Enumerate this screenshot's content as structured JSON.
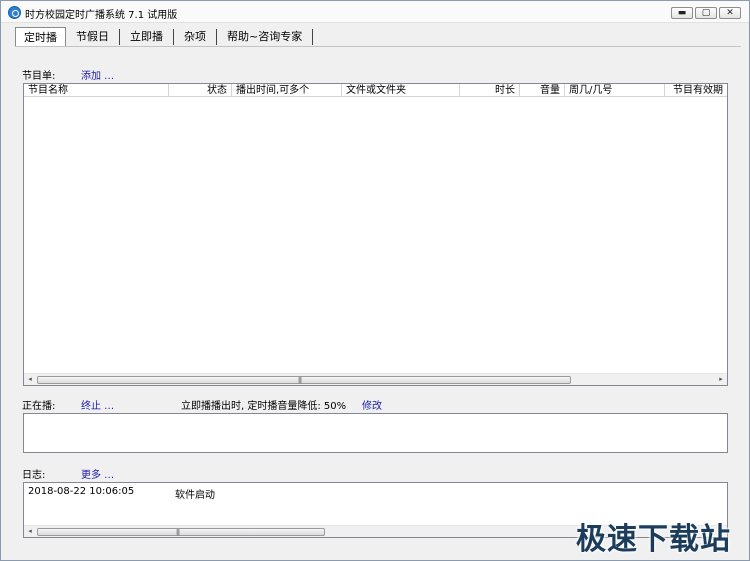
{
  "window": {
    "title": "时方校园定时广播系统 7.1 试用版",
    "buttons": {
      "minimize": "▬",
      "maximize": "▢",
      "close": "✕"
    }
  },
  "tabs": [
    {
      "label": "定时播",
      "active": true
    },
    {
      "label": "节假日"
    },
    {
      "label": "立即播"
    },
    {
      "label": "杂项"
    },
    {
      "label": "帮助~咨询专家"
    }
  ],
  "program": {
    "label": "节目单:",
    "add_link": "添加 …",
    "columns": [
      "节目名称",
      "状态",
      "播出时间,可多个",
      "文件或文件夹",
      "时长",
      "音量",
      "周几/几号",
      "节目有效期"
    ]
  },
  "scroll": {
    "left": "◂",
    "right": "▸",
    "grip": "|||"
  },
  "playing": {
    "label": "正在播:",
    "stop_link": "终止 …",
    "note": "立即播播出时, 定时播音量降低: 50%",
    "edit_link": "修改"
  },
  "log": {
    "label": "日志:",
    "more_link": "更多 …",
    "entries": [
      {
        "time": "2018-08-22 10:06:05",
        "message": "软件启动"
      }
    ]
  },
  "watermark": "极速下载站"
}
